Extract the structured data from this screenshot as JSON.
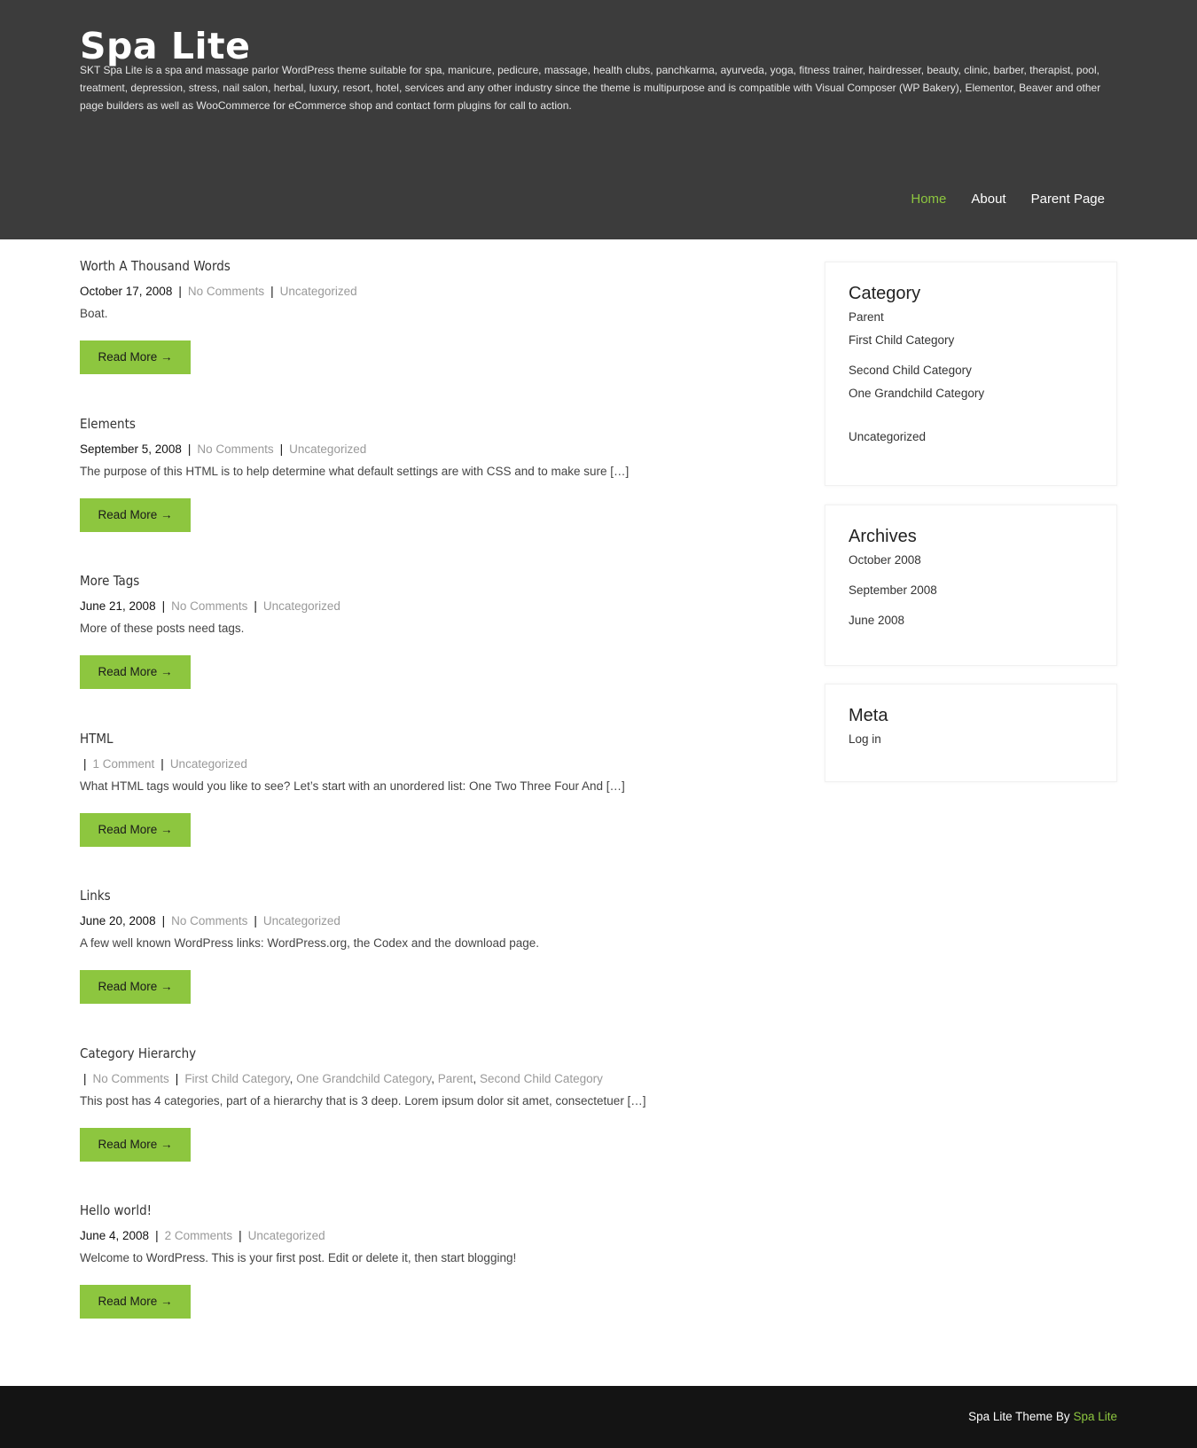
{
  "colors": {
    "header_bg": "#3c3c3c",
    "accent": "#8dc63f",
    "footer_bg": "#141414"
  },
  "header": {
    "title": "Spa Lite",
    "description": "SKT Spa Lite is a spa and massage parlor WordPress theme suitable for spa, manicure, pedicure, massage, health clubs, panchkarma, ayurveda, yoga, fitness trainer, hairdresser, beauty, clinic, barber, therapist, pool, treatment, depression, stress, nail salon, herbal, luxury, resort, hotel, services and any other industry since the theme is multipurpose and is compatible with Visual Composer (WP Bakery), Elementor, Beaver and other page builders as well as WooCommerce for eCommerce shop and contact form plugins for call to action.",
    "nav": [
      {
        "label": "Home",
        "active": true
      },
      {
        "label": "About",
        "active": false
      },
      {
        "label": "Parent Page",
        "active": false
      }
    ]
  },
  "posts": [
    {
      "title": "Worth A Thousand Words",
      "date": "October 17, 2008",
      "comments": "No Comments",
      "categories": [
        "Uncategorized"
      ],
      "excerpt": "Boat.",
      "read_more": "Read More →"
    },
    {
      "title": "Elements",
      "date": "September 5, 2008",
      "comments": "No Comments",
      "categories": [
        "Uncategorized"
      ],
      "excerpt": "The purpose of this HTML is to help determine what default settings are with CSS and to make sure […]",
      "read_more": "Read More →"
    },
    {
      "title": "More Tags",
      "date": "June 21, 2008",
      "comments": "No Comments",
      "categories": [
        "Uncategorized"
      ],
      "excerpt": "More of these posts need tags.",
      "read_more": "Read More →"
    },
    {
      "title": "HTML",
      "date": "",
      "comments": "1 Comment",
      "categories": [
        "Uncategorized"
      ],
      "excerpt": "What HTML tags would you like to see? Let’s start with an unordered list: One Two Three Four And […]",
      "read_more": "Read More →"
    },
    {
      "title": "Links",
      "date": "June 20, 2008",
      "comments": "No Comments",
      "categories": [
        "Uncategorized"
      ],
      "excerpt": "A few well known WordPress links: WordPress.org, the Codex and the download page.",
      "read_more": "Read More →"
    },
    {
      "title": "Category Hierarchy",
      "date": "",
      "comments": "No Comments",
      "categories": [
        "First Child Category",
        "One Grandchild Category",
        "Parent",
        "Second Child Category"
      ],
      "excerpt": "This post has 4 categories, part of a hierarchy that is 3 deep. Lorem ipsum dolor sit amet, consectetuer […]",
      "read_more": "Read More →"
    },
    {
      "title": "Hello world!",
      "date": "June 4, 2008",
      "comments": "2 Comments",
      "categories": [
        "Uncategorized"
      ],
      "excerpt": "Welcome to WordPress. This is your first post. Edit or delete it, then start blogging!",
      "read_more": "Read More →"
    }
  ],
  "sidebar": {
    "category": {
      "title": "Category",
      "items": [
        "Parent",
        "First Child Category",
        "Second Child Category",
        "One Grandchild Category",
        "Uncategorized"
      ]
    },
    "archives": {
      "title": "Archives",
      "items": [
        "October 2008",
        "September 2008",
        "June 2008"
      ]
    },
    "meta": {
      "title": "Meta",
      "items": [
        "Log in"
      ]
    }
  },
  "footer": {
    "text": "Spa Lite Theme By",
    "link": "Spa Lite"
  }
}
